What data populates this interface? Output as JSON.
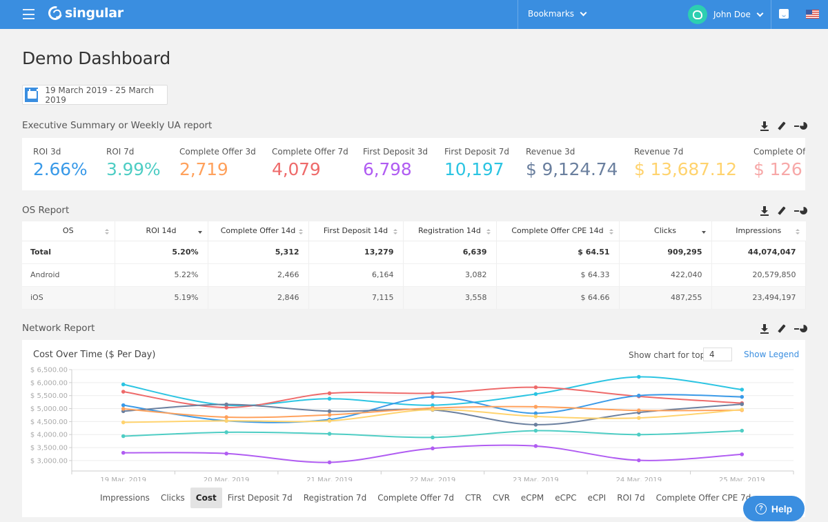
{
  "topbar": {
    "brand": "singular",
    "bookmarks_label": "Bookmarks",
    "user_name": "John Doe",
    "accent_color": "#3a8ee0"
  },
  "page": {
    "title": "Demo Dashboard",
    "date_range": "19 March 2019 - 25 March 2019"
  },
  "executive_summary": {
    "title": "Executive Summary or Weekly UA report",
    "kpis": [
      {
        "label": "ROI 3d",
        "value": "2.66%",
        "color": "#3a9ae8"
      },
      {
        "label": "ROI 7d",
        "value": "3.99%",
        "color": "#4ecdc4"
      },
      {
        "label": "Complete Offer 3d",
        "value": "2,719",
        "color": "#ffa15c"
      },
      {
        "label": "Complete Offer 7d",
        "value": "4,079",
        "color": "#ee6a6a"
      },
      {
        "label": "First Deposit 3d",
        "value": "6,798",
        "color": "#b05cf2"
      },
      {
        "label": "First Deposit 7d",
        "value": "10,197",
        "color": "#2bc4e2"
      },
      {
        "label": "Revenue 3d",
        "value": "$ 9,124.74",
        "color": "#6a7f9e"
      },
      {
        "label": "Revenue 7d",
        "value": "$ 13,687.12",
        "color": "#ffd36e"
      },
      {
        "label": "Complete Offe",
        "value": "$ 126",
        "color": "#f7a8a8"
      }
    ]
  },
  "os_report": {
    "title": "OS Report",
    "columns": [
      {
        "label": "OS",
        "sort": "both"
      },
      {
        "label": "ROI 14d",
        "sort": "down"
      },
      {
        "label": "Complete Offer 14d",
        "sort": "both"
      },
      {
        "label": "First Deposit 14d",
        "sort": "both"
      },
      {
        "label": "Registration 14d",
        "sort": "both"
      },
      {
        "label": "Complete Offer CPE 14d",
        "sort": "both"
      },
      {
        "label": "Clicks",
        "sort": "down"
      },
      {
        "label": "Impressions",
        "sort": "both"
      }
    ],
    "rows": [
      [
        "Total",
        "5.20%",
        "5,312",
        "13,279",
        "6,639",
        "$ 64.51",
        "909,295",
        "44,074,047"
      ],
      [
        "Android",
        "5.22%",
        "2,466",
        "6,164",
        "3,082",
        "$ 64.33",
        "422,040",
        "20,579,850"
      ],
      [
        "iOS",
        "5.19%",
        "2,846",
        "7,115",
        "3,558",
        "$ 64.66",
        "487,255",
        "23,494,197"
      ]
    ]
  },
  "network_report": {
    "title": "Network Report",
    "show_top_label": "Show chart for top",
    "show_top_value": "4",
    "show_legend_label": "Show Legend",
    "metric_tabs": [
      "Impressions",
      "Clicks",
      "Cost",
      "First Deposit 7d",
      "Registration 7d",
      "Complete Offer 7d",
      "CTR",
      "CVR",
      "eCPM",
      "eCPC",
      "eCPI",
      "ROI 7d",
      "Complete Offer CPE 7d"
    ],
    "active_metric": "Cost"
  },
  "chart_data": {
    "type": "line",
    "title": "Cost Over Time ($ Per Day)",
    "xlabel": "",
    "ylabel": "",
    "x": [
      "19 Mar, 2019",
      "20 Mar, 2019",
      "21 Mar, 2019",
      "22 Mar, 2019",
      "23 Mar, 2019",
      "24 Mar, 2019",
      "25 Mar, 2019"
    ],
    "yticks": [
      "$ 3,000.00",
      "$ 3,500.00",
      "$ 4,000.00",
      "$ 4,500.00",
      "$ 5,000.00",
      "$ 5,500.00",
      "$ 6,000.00",
      "$ 6,500.00"
    ],
    "ylim": [
      2600,
      6500
    ],
    "grid": true,
    "legend": "hidden",
    "series": [
      {
        "name": "Series 1",
        "color": "#2bc4e2",
        "values": [
          5930,
          5130,
          5380,
          5130,
          5560,
          6220,
          5730
        ]
      },
      {
        "name": "Series 2",
        "color": "#ee6a6a",
        "values": [
          5650,
          5040,
          5590,
          5590,
          5820,
          5470,
          5210
        ]
      },
      {
        "name": "Series 3",
        "color": "#3a9ae8",
        "values": [
          5130,
          4530,
          4580,
          5450,
          4820,
          5500,
          5450
        ]
      },
      {
        "name": "Series 4",
        "color": "#6a7f9e",
        "values": [
          4900,
          5160,
          4900,
          4950,
          4380,
          4850,
          5170
        ]
      },
      {
        "name": "Series 5",
        "color": "#ffa15c",
        "values": [
          4990,
          4670,
          4760,
          5020,
          5070,
          4930,
          4940
        ]
      },
      {
        "name": "Series 6",
        "color": "#ffd36e",
        "values": [
          4470,
          4530,
          4530,
          4960,
          4700,
          4640,
          4960
        ]
      },
      {
        "name": "Series 7",
        "color": "#4ecdc4",
        "values": [
          3940,
          4090,
          4030,
          3890,
          4150,
          4000,
          4150
        ]
      },
      {
        "name": "Series 8",
        "color": "#b05cf2",
        "values": [
          3300,
          3270,
          2930,
          3470,
          3560,
          3010,
          3240
        ]
      }
    ]
  },
  "help": {
    "label": "Help"
  }
}
